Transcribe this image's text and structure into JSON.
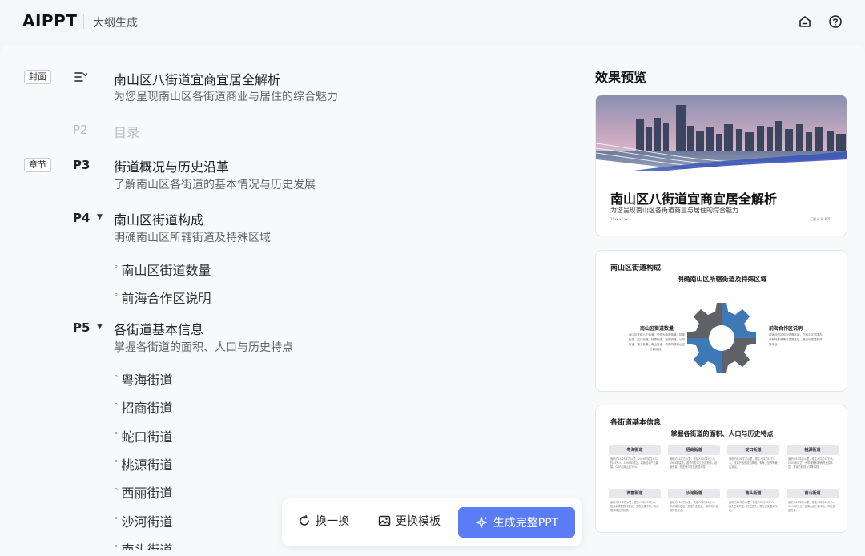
{
  "header": {
    "logo": "AIPPT",
    "subtitle": "大纲生成",
    "icons": [
      "home-icon",
      "help-icon"
    ]
  },
  "outline": {
    "cover": {
      "tag": "封面",
      "title": "南山区八街道宜商宜居全解析",
      "desc": "为您呈现南山区各街道商业与居住的综合魅力"
    },
    "p2": {
      "page": "P2",
      "title": "目录"
    },
    "p3": {
      "tag": "章节",
      "page": "P3",
      "title": "街道概况与历史沿革",
      "desc": "了解南山区各街道的基本情况与历史发展"
    },
    "p4": {
      "page": "P4",
      "title": "南山区街道构成",
      "desc": "明确南山区所辖街道及特殊区域",
      "bullets": [
        "南山区街道数量",
        "前海合作区说明"
      ]
    },
    "p5": {
      "page": "P5",
      "title": "各街道基本信息",
      "desc": "掌握各街道的面积、人口与历史特点",
      "bullets": [
        "粤海街道",
        "招商街道",
        "蛇口街道",
        "桃源街道",
        "西丽街道",
        "沙河街道",
        "南头街道"
      ]
    }
  },
  "preview": {
    "title": "效果预览",
    "card1": {
      "title": "南山区八街道宜商宜居全解析",
      "subtitle": "为您呈现南山区各街道商业与居住的综合魅力",
      "date": "20xx.xx.xx",
      "author": "汇报人:AI PPT"
    },
    "card2": {
      "heading": "南山区街道构成",
      "subheading": "明确南山区所辖街道及特殊区域",
      "left_title": "南山区街道数量",
      "left_text": "南山区下辖八个街道，分别为粤海街道、招商街道、蛇口街道、桃源街道、西丽街道、沙河街道、南头街道、南山街道，共同构成南山区行政区划。",
      "right_title": "前海合作区说明",
      "right_text": "前海合作区作为特殊区域，在南山区范围内享有特殊政策与发展定位，是深圳重要的开放平台。"
    },
    "card3": {
      "heading": "各街道基本信息",
      "subheading": "掌握各街道的面积、人口与历史特点",
      "cells": [
        {
          "name": "粤海街道",
          "text": "面积约14.25平方公里，2020年常住人口约45万人，1999年成立，高新技术产业聚集，GDP占南山区30%。"
        },
        {
          "name": "招商街道",
          "text": "面积约11平方公里，常住人口约19万人，1984年建成，港湾与蛇口工业区相邻，设施完善，历史悠久文化底蕴深厚。"
        },
        {
          "name": "蛇口街道",
          "text": "面积约9.08平方公里，常住人口约14万人，改革开放的前沿阵地，有海上世界等著名景点。"
        },
        {
          "name": "桃源街道",
          "text": "面积约37平方公里，常住人口约17万人，2005年成立，大学城等科研教育资源丰富，有南方科技大学等高校。"
        },
        {
          "name": "西丽街道",
          "text": "面积约47平方公里，常住人口约35万人，是深圳重要的科教区，生态资源丰富，有西丽湖等自然景观。"
        },
        {
          "name": "沙河街道",
          "text": "面积约21平方公里，常住人口约16万人，华侨城所在地，文旅产业发达，拥有欢乐谷等知名景点。"
        },
        {
          "name": "南头街道",
          "text": "面积约11平方公里，常住人口约30万人，南头古城所在，历史悠久，曾为宝安县治所在。"
        },
        {
          "name": "南山街道",
          "text": "面积约18平方公里，常住人口约26万人，1990年设立，是南山区行政中心，商业配套完善。"
        }
      ]
    }
  },
  "actions": {
    "shuffle": "换一换",
    "template": "更换模板",
    "generate": "生成完整PPT"
  }
}
